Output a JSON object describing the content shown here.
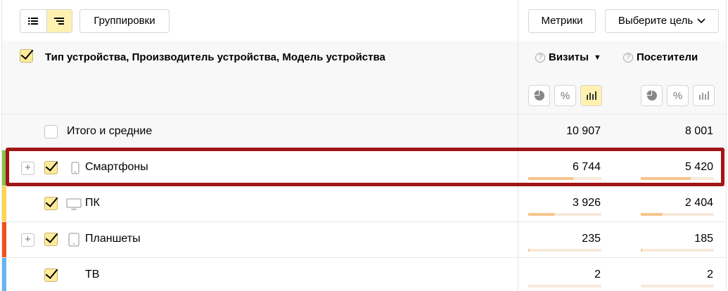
{
  "toolbar": {
    "groupings_label": "Группировки",
    "metrics_label": "Метрики",
    "goal_label": "Выберите цель"
  },
  "header": {
    "dimension_title": "Тип устройства, Производитель устройства, Модель устройства",
    "metrics": [
      {
        "label": "Визиты",
        "sorted": true
      },
      {
        "label": "Посетители",
        "sorted": false
      }
    ],
    "question_glyph": "?"
  },
  "total": {
    "label": "Итого и средние",
    "visits": "10 907",
    "visitors": "8 001"
  },
  "rows": [
    {
      "label": "Смартфоны",
      "icon": "smartphone-icon",
      "expandable": true,
      "visits": "6 744",
      "visitors": "5 420",
      "visits_share": 0.62,
      "visitors_share": 0.68,
      "color": "#8bc34a"
    },
    {
      "label": "ПК",
      "icon": "desktop-icon",
      "expandable": false,
      "visits": "3 926",
      "visitors": "2 404",
      "visits_share": 0.36,
      "visitors_share": 0.3,
      "color": "#ffd54f"
    },
    {
      "label": "Планшеты",
      "icon": "tablet-icon",
      "expandable": true,
      "visits": "235",
      "visitors": "185",
      "visits_share": 0.022,
      "visitors_share": 0.023,
      "color": "#f4511e"
    },
    {
      "label": "ТВ",
      "icon": "",
      "expandable": false,
      "visits": "2",
      "visitors": "2",
      "visits_share": 0.0,
      "visitors_share": 0.0,
      "color": "#64b5f6"
    }
  ],
  "colors": {
    "accent": "#fff1b0",
    "highlight": "#a01515",
    "bar": "#f5c48c",
    "bar_track": "#f7eadb"
  }
}
